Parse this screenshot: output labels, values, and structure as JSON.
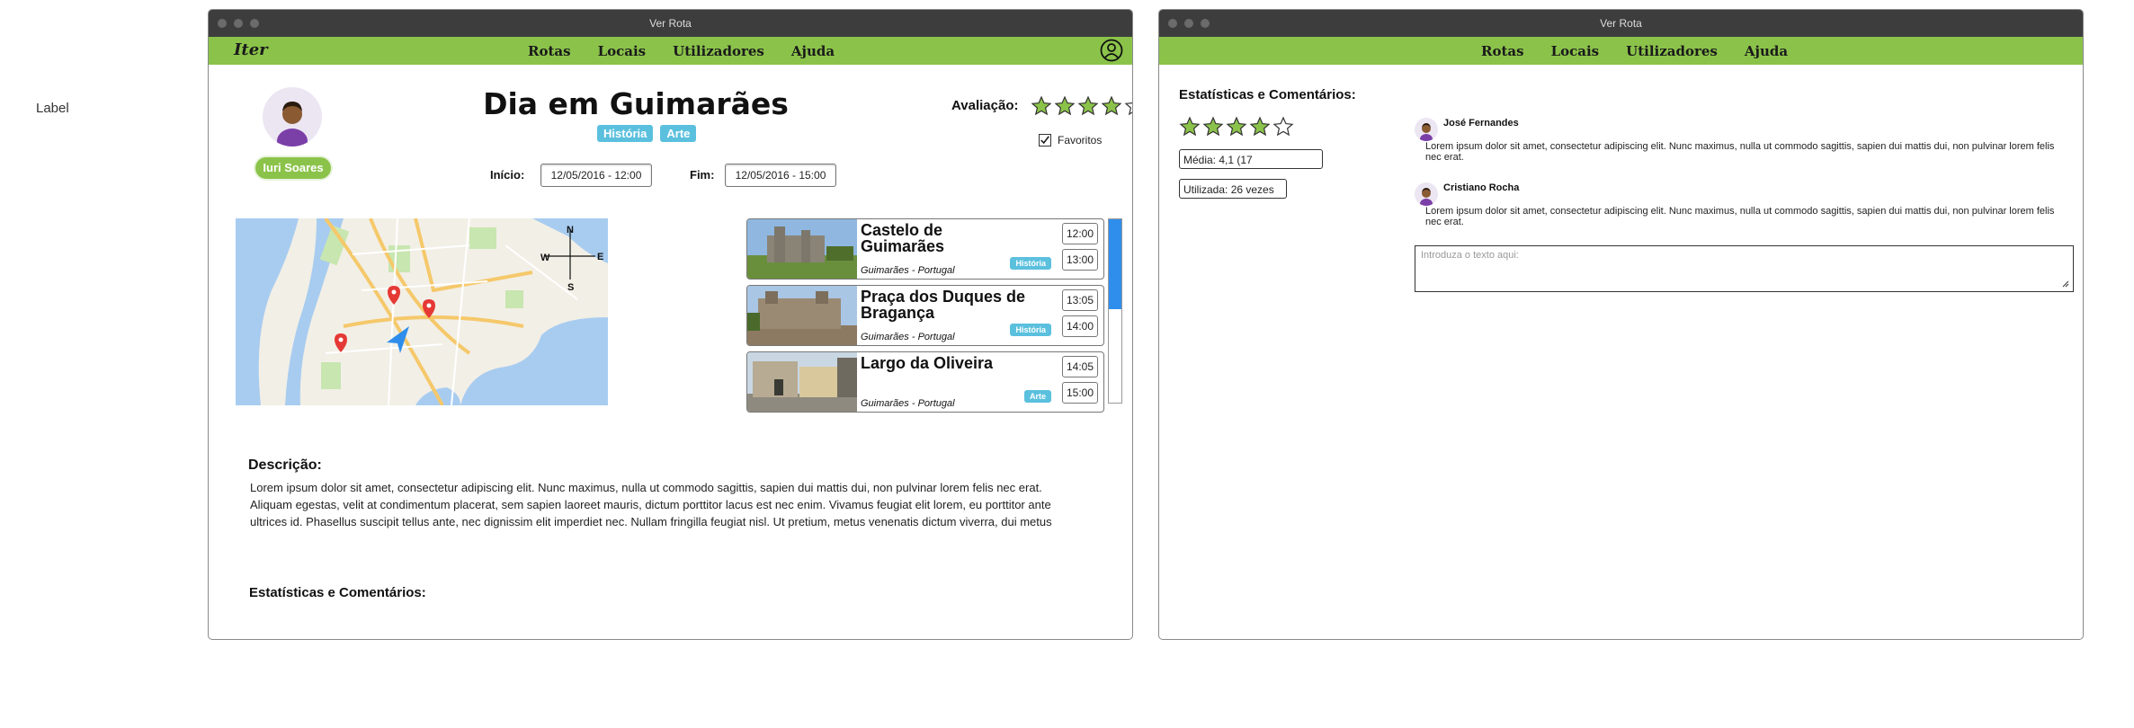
{
  "side_label": "Label",
  "window1": {
    "title": "Ver Rota",
    "logo": "Iter",
    "nav": [
      "Rotas",
      "Locais",
      "Utilizadores",
      "Ajuda"
    ],
    "user_name": "Iuri Soares",
    "route_title": "Dia em Guimarães",
    "tags": [
      "História",
      "Arte"
    ],
    "start_label": "Início:",
    "start_value": "12/05/2016 - 12:00",
    "end_label": "Fim:",
    "end_value": "12/05/2016 - 15:00",
    "rating_label": "Avaliação:",
    "rating": 4,
    "rating_max": 5,
    "favorites_label": "Favoritos",
    "favorites_checked": true,
    "compass": {
      "n": "N",
      "s": "S",
      "e": "E",
      "w": "W"
    },
    "places": [
      {
        "name": "Castelo de Guimarães",
        "location": "Guimarães - Portugal",
        "tag": "História",
        "start": "12:00",
        "end": "13:00"
      },
      {
        "name": "Praça dos Duques de Bragança",
        "location": "Guimarães - Portugal",
        "tag": "História",
        "start": "13:05",
        "end": "14:00"
      },
      {
        "name": "Largo da Oliveira",
        "location": "Guimarães - Portugal",
        "tag": "Arte",
        "start": "14:05",
        "end": "15:00"
      }
    ],
    "description_title": "Descrição:",
    "description_text": "Lorem ipsum dolor sit amet, consectetur adipiscing elit. Nunc maximus, nulla ut commodo sagittis, sapien dui mattis dui, non pulvinar lorem felis nec erat. Aliquam egestas, velit at condimentum placerat, sem sapien laoreet mauris, dictum porttitor lacus est nec enim. Vivamus feugiat elit lorem, eu porttitor ante ultrices id. Phasellus suscipit tellus ante, nec dignissim elit imperdiet nec. Nullam fringilla feugiat nisl. Ut pretium, metus venenatis dictum viverra, dui metus",
    "stats_title": "Estatísticas e Comentários:"
  },
  "window2": {
    "title": "Ver Rota",
    "nav": [
      "Rotas",
      "Locais",
      "Utilizadores",
      "Ajuda"
    ],
    "stats_title": "Estatísticas e Comentários:",
    "rating": 4,
    "rating_max": 5,
    "average_text": "Média: 4,1 (17",
    "used_text": "Utilizada: 26 vezes",
    "comments": [
      {
        "author": "José Fernandes",
        "text": "Lorem ipsum dolor sit amet, consectetur adipiscing elit. Nunc maximus, nulla ut commodo sagittis, sapien dui mattis dui, non pulvinar lorem felis nec erat."
      },
      {
        "author": "Cristiano Rocha",
        "text": "Lorem ipsum dolor sit amet, consectetur adipiscing elit. Nunc maximus, nulla ut commodo sagittis, sapien dui mattis dui, non pulvinar lorem felis nec erat."
      }
    ],
    "comment_placeholder": "Introduza o texto aqui:"
  },
  "colors": {
    "nav_green": "#8bc34a",
    "tag_blue": "#5bc0de",
    "star_green": "#8bc34a",
    "scroll_blue": "#2f8eec",
    "titlebar": "#3d3d3d"
  },
  "icons": {
    "user": "user-circle-icon",
    "star": "star-icon",
    "check": "check-icon",
    "pin": "map-pin-icon",
    "arrow": "navigation-arrow-icon"
  }
}
